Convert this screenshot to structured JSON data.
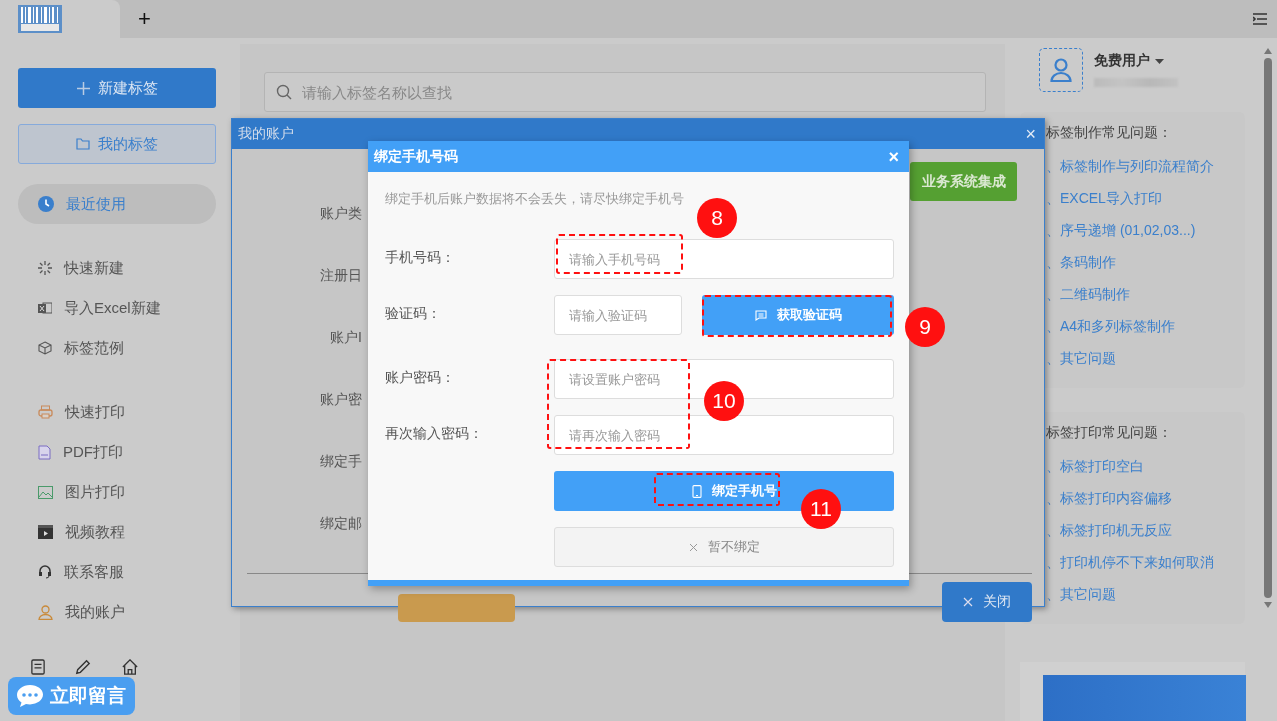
{
  "top_bar": {
    "add_tab": "+"
  },
  "sidebar": {
    "new_button": "新建标签",
    "my_labels_button": "我的标签",
    "groups": [
      [
        {
          "label": "最近使用",
          "selected": true
        }
      ],
      [
        {
          "label": "快速新建",
          "selected": false
        },
        {
          "label": "导入Excel新建",
          "selected": false
        },
        {
          "label": "标签范例",
          "selected": false
        }
      ],
      [
        {
          "label": "快速打印",
          "selected": false
        },
        {
          "label": "PDF打印",
          "selected": false
        },
        {
          "label": "图片打印",
          "selected": false
        },
        {
          "label": "视频教程",
          "selected": false
        },
        {
          "label": "联系客服",
          "selected": false
        },
        {
          "label": "我的账户",
          "selected": false
        }
      ]
    ],
    "chat_button": "立即留言"
  },
  "search": {
    "placeholder": "请输入标签名称以查找"
  },
  "user": {
    "name": "免费用户"
  },
  "help_cards": [
    {
      "title": "标签制作常见问题：",
      "links": [
        "、标签制作与列印流程简介",
        "、EXCEL导入打印",
        "、序号递增 (01,02,03...)",
        "、条码制作",
        "、二维码制作",
        "、A4和多列标签制作",
        "、其它问题"
      ]
    },
    {
      "title": "标签打印常见问题：",
      "links": [
        "、标签打印空白",
        "、标签打印内容偏移",
        "、标签打印机无反应",
        "、打印机停不下来如何取消",
        "、其它问题"
      ]
    }
  ],
  "account_dialog": {
    "title": "我的账户",
    "close": "×",
    "labels": [
      "账户类",
      "注册日",
      "账户I",
      "账户密",
      "绑定手",
      "绑定邮"
    ],
    "integration_button": "业务系统集成",
    "close_button": "关闭"
  },
  "bind_dialog": {
    "title": "绑定手机号码",
    "close": "×",
    "notice": "绑定手机后账户数据将不会丢失，请尽快绑定手机号",
    "fields": [
      {
        "label": "手机号码：",
        "placeholder": "请输入手机号码"
      },
      {
        "label": "验证码：",
        "placeholder": "请输入验证码"
      },
      {
        "label": "账户密码：",
        "placeholder": "请设置账户密码"
      },
      {
        "label": "再次输入密码：",
        "placeholder": "请再次输入密码"
      }
    ],
    "get_code_button": "获取验证码",
    "bind_button": "绑定手机号",
    "skip_button": "暂不绑定"
  },
  "annotations": [
    {
      "label": "8"
    },
    {
      "label": "9"
    },
    {
      "label": "10"
    },
    {
      "label": "11"
    }
  ]
}
